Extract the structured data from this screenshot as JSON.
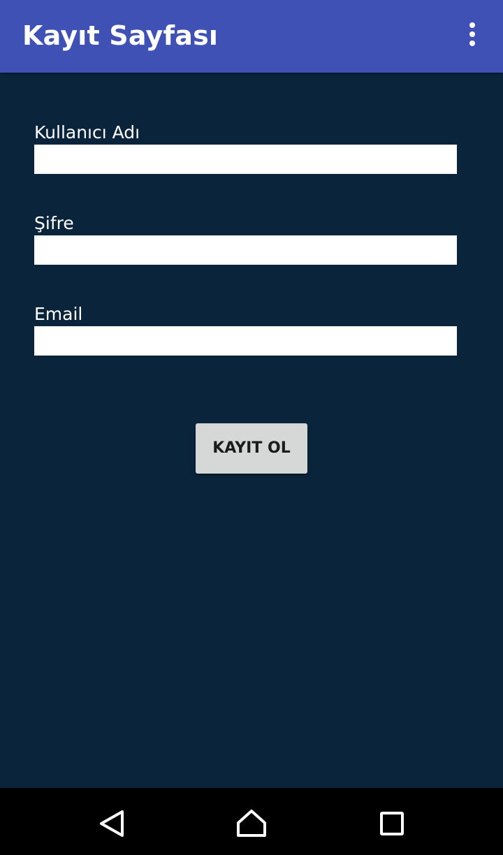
{
  "app_bar": {
    "title": "Kayıt Sayfası",
    "background": "#3f51b5",
    "overflow_icon": "more-vert-icon"
  },
  "form": {
    "background": "#0a253b",
    "fields": [
      {
        "label": "Kullanıcı Adı",
        "value": "",
        "type": "text"
      },
      {
        "label": "Şifre",
        "value": "",
        "type": "password"
      },
      {
        "label": "Email",
        "value": "",
        "type": "email"
      }
    ],
    "submit_label": "KAYIT OL"
  },
  "nav_bar": {
    "back_icon": "back-triangle-icon",
    "home_icon": "home-icon",
    "recents_icon": "recents-square-icon"
  }
}
